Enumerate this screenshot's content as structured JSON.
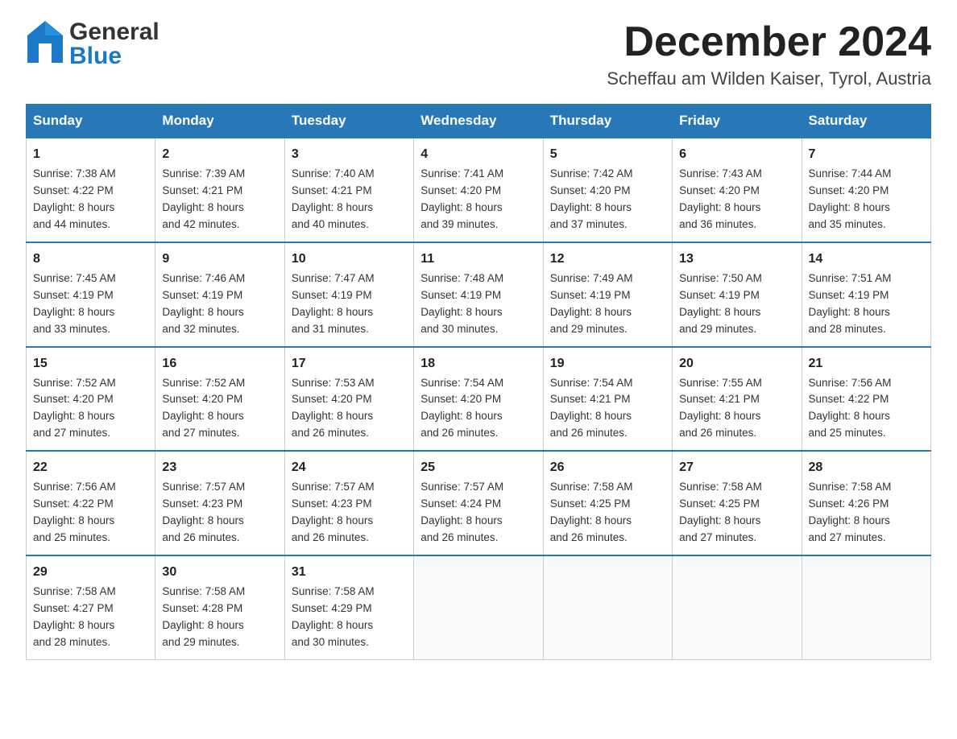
{
  "header": {
    "logo_general": "General",
    "logo_blue": "Blue",
    "month_title": "December 2024",
    "location": "Scheffau am Wilden Kaiser, Tyrol, Austria"
  },
  "weekdays": [
    "Sunday",
    "Monday",
    "Tuesday",
    "Wednesday",
    "Thursday",
    "Friday",
    "Saturday"
  ],
  "weeks": [
    [
      {
        "day": "1",
        "sunrise": "7:38 AM",
        "sunset": "4:22 PM",
        "daylight": "8 hours and 44 minutes."
      },
      {
        "day": "2",
        "sunrise": "7:39 AM",
        "sunset": "4:21 PM",
        "daylight": "8 hours and 42 minutes."
      },
      {
        "day": "3",
        "sunrise": "7:40 AM",
        "sunset": "4:21 PM",
        "daylight": "8 hours and 40 minutes."
      },
      {
        "day": "4",
        "sunrise": "7:41 AM",
        "sunset": "4:20 PM",
        "daylight": "8 hours and 39 minutes."
      },
      {
        "day": "5",
        "sunrise": "7:42 AM",
        "sunset": "4:20 PM",
        "daylight": "8 hours and 37 minutes."
      },
      {
        "day": "6",
        "sunrise": "7:43 AM",
        "sunset": "4:20 PM",
        "daylight": "8 hours and 36 minutes."
      },
      {
        "day": "7",
        "sunrise": "7:44 AM",
        "sunset": "4:20 PM",
        "daylight": "8 hours and 35 minutes."
      }
    ],
    [
      {
        "day": "8",
        "sunrise": "7:45 AM",
        "sunset": "4:19 PM",
        "daylight": "8 hours and 33 minutes."
      },
      {
        "day": "9",
        "sunrise": "7:46 AM",
        "sunset": "4:19 PM",
        "daylight": "8 hours and 32 minutes."
      },
      {
        "day": "10",
        "sunrise": "7:47 AM",
        "sunset": "4:19 PM",
        "daylight": "8 hours and 31 minutes."
      },
      {
        "day": "11",
        "sunrise": "7:48 AM",
        "sunset": "4:19 PM",
        "daylight": "8 hours and 30 minutes."
      },
      {
        "day": "12",
        "sunrise": "7:49 AM",
        "sunset": "4:19 PM",
        "daylight": "8 hours and 29 minutes."
      },
      {
        "day": "13",
        "sunrise": "7:50 AM",
        "sunset": "4:19 PM",
        "daylight": "8 hours and 29 minutes."
      },
      {
        "day": "14",
        "sunrise": "7:51 AM",
        "sunset": "4:19 PM",
        "daylight": "8 hours and 28 minutes."
      }
    ],
    [
      {
        "day": "15",
        "sunrise": "7:52 AM",
        "sunset": "4:20 PM",
        "daylight": "8 hours and 27 minutes."
      },
      {
        "day": "16",
        "sunrise": "7:52 AM",
        "sunset": "4:20 PM",
        "daylight": "8 hours and 27 minutes."
      },
      {
        "day": "17",
        "sunrise": "7:53 AM",
        "sunset": "4:20 PM",
        "daylight": "8 hours and 26 minutes."
      },
      {
        "day": "18",
        "sunrise": "7:54 AM",
        "sunset": "4:20 PM",
        "daylight": "8 hours and 26 minutes."
      },
      {
        "day": "19",
        "sunrise": "7:54 AM",
        "sunset": "4:21 PM",
        "daylight": "8 hours and 26 minutes."
      },
      {
        "day": "20",
        "sunrise": "7:55 AM",
        "sunset": "4:21 PM",
        "daylight": "8 hours and 26 minutes."
      },
      {
        "day": "21",
        "sunrise": "7:56 AM",
        "sunset": "4:22 PM",
        "daylight": "8 hours and 25 minutes."
      }
    ],
    [
      {
        "day": "22",
        "sunrise": "7:56 AM",
        "sunset": "4:22 PM",
        "daylight": "8 hours and 25 minutes."
      },
      {
        "day": "23",
        "sunrise": "7:57 AM",
        "sunset": "4:23 PM",
        "daylight": "8 hours and 26 minutes."
      },
      {
        "day": "24",
        "sunrise": "7:57 AM",
        "sunset": "4:23 PM",
        "daylight": "8 hours and 26 minutes."
      },
      {
        "day": "25",
        "sunrise": "7:57 AM",
        "sunset": "4:24 PM",
        "daylight": "8 hours and 26 minutes."
      },
      {
        "day": "26",
        "sunrise": "7:58 AM",
        "sunset": "4:25 PM",
        "daylight": "8 hours and 26 minutes."
      },
      {
        "day": "27",
        "sunrise": "7:58 AM",
        "sunset": "4:25 PM",
        "daylight": "8 hours and 27 minutes."
      },
      {
        "day": "28",
        "sunrise": "7:58 AM",
        "sunset": "4:26 PM",
        "daylight": "8 hours and 27 minutes."
      }
    ],
    [
      {
        "day": "29",
        "sunrise": "7:58 AM",
        "sunset": "4:27 PM",
        "daylight": "8 hours and 28 minutes."
      },
      {
        "day": "30",
        "sunrise": "7:58 AM",
        "sunset": "4:28 PM",
        "daylight": "8 hours and 29 minutes."
      },
      {
        "day": "31",
        "sunrise": "7:58 AM",
        "sunset": "4:29 PM",
        "daylight": "8 hours and 30 minutes."
      },
      null,
      null,
      null,
      null
    ]
  ],
  "labels": {
    "sunrise_prefix": "Sunrise: ",
    "sunset_prefix": "Sunset: ",
    "daylight_prefix": "Daylight: "
  }
}
